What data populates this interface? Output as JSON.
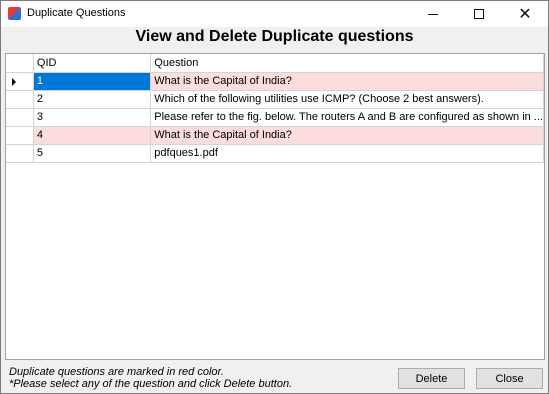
{
  "window": {
    "title": "Duplicate Questions"
  },
  "heading": "View and Delete Duplicate questions",
  "grid": {
    "columns": [
      "QID",
      "Question"
    ],
    "rows": [
      {
        "qid": "1",
        "question": "What is the Capital of India?",
        "duplicate": true,
        "selected": true
      },
      {
        "qid": "2",
        "question": "Which of the following utilities use ICMP? (Choose 2 best answers).",
        "duplicate": false,
        "selected": false
      },
      {
        "qid": "3",
        "question": "Please refer to the fig. below. The routers A and B are configured as shown in ...",
        "duplicate": false,
        "selected": false
      },
      {
        "qid": "4",
        "question": "What is the Capital of India?",
        "duplicate": true,
        "selected": false
      },
      {
        "qid": "5",
        "question": "pdfques1.pdf",
        "duplicate": false,
        "selected": false
      }
    ]
  },
  "footer": {
    "note1": "Duplicate questions are marked in red color.",
    "note2": "*Please select any of the question and click Delete button.",
    "delete_label": "Delete",
    "close_label": "Close"
  },
  "colors": {
    "duplicate_row": "#fbdddd",
    "selection": "#0078d7"
  }
}
